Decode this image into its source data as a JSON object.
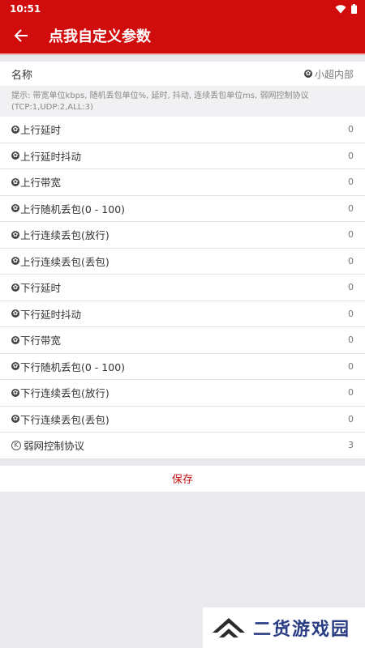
{
  "status": {
    "time": "10:51"
  },
  "appbar": {
    "title": "点我自定义参数"
  },
  "name_row": {
    "label": "名称",
    "value": "小超内部"
  },
  "hint": "提示: 带宽单位kbps, 随机丢包单位%, 延时, 抖动, 连续丢包单位ms, 弱网控制协议(TCP:1,UDP:2,ALL:3)",
  "rows": [
    {
      "label": "上行延时",
      "value": "0"
    },
    {
      "label": "上行延时抖动",
      "value": "0"
    },
    {
      "label": "上行带宽",
      "value": "0"
    },
    {
      "label": "上行随机丢包(0 - 100)",
      "value": "0"
    },
    {
      "label": "上行连续丢包(放行)",
      "value": "0"
    },
    {
      "label": "上行连续丢包(丢包)",
      "value": "0"
    },
    {
      "label": "下行延时",
      "value": "0"
    },
    {
      "label": "下行延时抖动",
      "value": "0"
    },
    {
      "label": "下行带宽",
      "value": "0"
    },
    {
      "label": "下行随机丢包(0 - 100)",
      "value": "0"
    },
    {
      "label": "下行连续丢包(放行)",
      "value": "0"
    },
    {
      "label": "下行连续丢包(丢包)",
      "value": "0"
    },
    {
      "label": "弱网控制协议",
      "value": "3"
    }
  ],
  "save_label": "保存",
  "watermark": {
    "text": "二货游戏园"
  },
  "colors": {
    "primary": "#d10c0c",
    "accent_text": "#c01010",
    "watermark": "#2a3c84"
  }
}
